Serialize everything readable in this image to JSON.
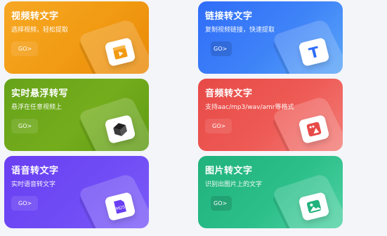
{
  "cards": [
    {
      "title": "视频转文字",
      "subtitle": "选择视频，轻松提取",
      "go": "GO>",
      "icon": "video-clapper-icon",
      "color": "#f19a12"
    },
    {
      "title": "链接转文字",
      "subtitle": "复制视频链接，快速提取",
      "go": "GO>",
      "icon": "text-t-icon",
      "color": "#3f83f8"
    },
    {
      "title": "实时悬浮转写",
      "subtitle": "悬浮在任意视频上",
      "go": "GO>",
      "icon": "cube-icon",
      "color": "#74ad1c"
    },
    {
      "title": "音频转文字",
      "subtitle": "支持aac/mp3/wav/amr等格式",
      "go": "GO>",
      "icon": "audio-file-icon",
      "color": "#ee5a55"
    },
    {
      "title": "语音转文字",
      "subtitle": "实时语音转文字",
      "go": "GO>",
      "icon": "mds-file-icon",
      "color": "#6f4cf5",
      "icon_label": "MDS"
    },
    {
      "title": "图片转文字",
      "subtitle": "识别出图片上的文字",
      "go": "GO>",
      "icon": "image-icon",
      "color": "#2cbf8a"
    }
  ]
}
